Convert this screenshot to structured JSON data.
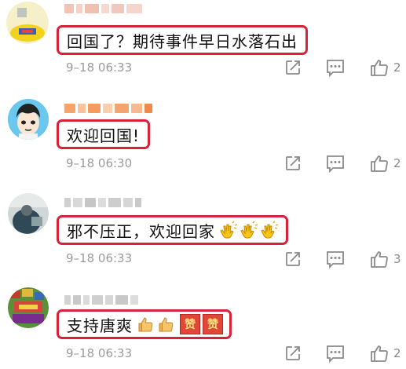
{
  "comments": [
    {
      "text": "回国了？期待事件早日水落石出",
      "time": "9–18 06:33",
      "likes": "2",
      "emoji": []
    },
    {
      "text": "欢迎回国!",
      "time": "9–18 06:30",
      "likes": "2",
      "emoji": []
    },
    {
      "text": "邪不压正，欢迎回家",
      "time": "9–18 06:33",
      "likes": "3",
      "emoji": [
        "clapping-hands",
        "clapping-hands",
        "clapping-hands"
      ]
    },
    {
      "text": "支持唐爽",
      "time": "9–18 06:33",
      "likes": "2",
      "emoji": [
        "thumbs-up",
        "thumbs-up",
        "zan-badge",
        "zan-badge"
      ]
    }
  ],
  "badge_text": "赞",
  "colors": {
    "highlight_border": "#d8223a",
    "meta_gray": "#9a9a9a",
    "icon_gray": "#8a8a8a"
  }
}
